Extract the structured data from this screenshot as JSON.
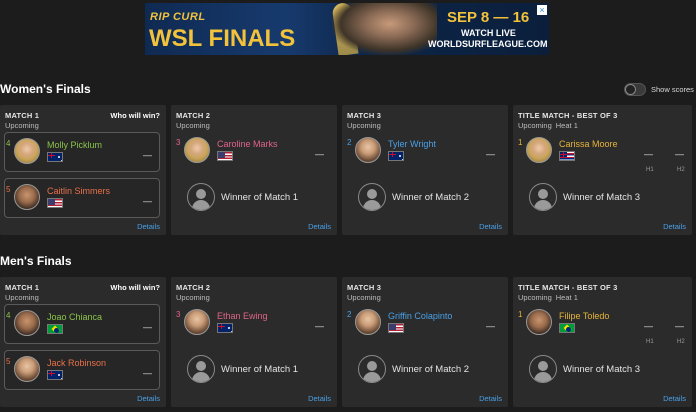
{
  "banner": {
    "brand": "RIP CURL",
    "event": "WSL FINALS",
    "dates": "SEP 8 — 16",
    "watch": "WATCH LIVE",
    "site": "WORLDSURFLEAGUE.COM",
    "close": "×"
  },
  "toggle": {
    "label": "Show scores",
    "on": false
  },
  "colors": {
    "green": "#8bc34a",
    "orange": "#e8714a",
    "pink": "#e0638a",
    "blue": "#4aa0e6",
    "gold": "#e6b43a",
    "link": "#4aa0e6"
  },
  "womens": {
    "title": "Women's Finals",
    "match1": {
      "head": "MATCH 1",
      "status": "Upcoming",
      "who": "Who will win?",
      "details": "Details",
      "p1": {
        "seed": "4",
        "name": "Molly Picklum",
        "flag": "AU",
        "score": "—"
      },
      "p2": {
        "seed": "5",
        "name": "Caitlin Simmers",
        "flag": "US",
        "score": "—"
      }
    },
    "match2": {
      "head": "MATCH 2",
      "status": "Upcoming",
      "details": "Details",
      "p1": {
        "seed": "3",
        "name": "Caroline Marks",
        "flag": "US",
        "score": "—"
      },
      "placeholder": "Winner of Match 1"
    },
    "match3": {
      "head": "MATCH 3",
      "status": "Upcoming",
      "details": "Details",
      "p1": {
        "seed": "2",
        "name": "Tyler Wright",
        "flag": "AU",
        "score": "—"
      },
      "placeholder": "Winner of Match 2"
    },
    "title_match": {
      "head": "TITLE MATCH - BEST OF 3",
      "status": "Upcoming",
      "heat": "Heat 1",
      "details": "Details",
      "p1": {
        "seed": "1",
        "name": "Carissa Moore",
        "flag": "HI",
        "h1": "—",
        "h2": "—"
      },
      "h1_label": "H1",
      "h2_label": "H2",
      "placeholder": "Winner of Match 3"
    }
  },
  "mens": {
    "title": "Men's Finals",
    "match1": {
      "head": "MATCH 1",
      "status": "Upcoming",
      "who": "Who will win?",
      "details": "Details",
      "p1": {
        "seed": "4",
        "name": "Joao Chianca",
        "flag": "BR",
        "score": "—"
      },
      "p2": {
        "seed": "5",
        "name": "Jack Robinson",
        "flag": "AU",
        "score": "—"
      }
    },
    "match2": {
      "head": "MATCH 2",
      "status": "Upcoming",
      "details": "Details",
      "p1": {
        "seed": "3",
        "name": "Ethan Ewing",
        "flag": "AU",
        "score": "—"
      },
      "placeholder": "Winner of Match 1"
    },
    "match3": {
      "head": "MATCH 3",
      "status": "Upcoming",
      "details": "Details",
      "p1": {
        "seed": "2",
        "name": "Griffin Colapinto",
        "flag": "US",
        "score": "—"
      },
      "placeholder": "Winner of Match 2"
    },
    "title_match": {
      "head": "TITLE MATCH - BEST OF 3",
      "status": "Upcoming",
      "heat": "Heat 1",
      "details": "Details",
      "p1": {
        "seed": "1",
        "name": "Filipe Toledo",
        "flag": "BR",
        "h1": "—",
        "h2": "—"
      },
      "h1_label": "H1",
      "h2_label": "H2",
      "placeholder": "Winner of Match 3"
    }
  }
}
